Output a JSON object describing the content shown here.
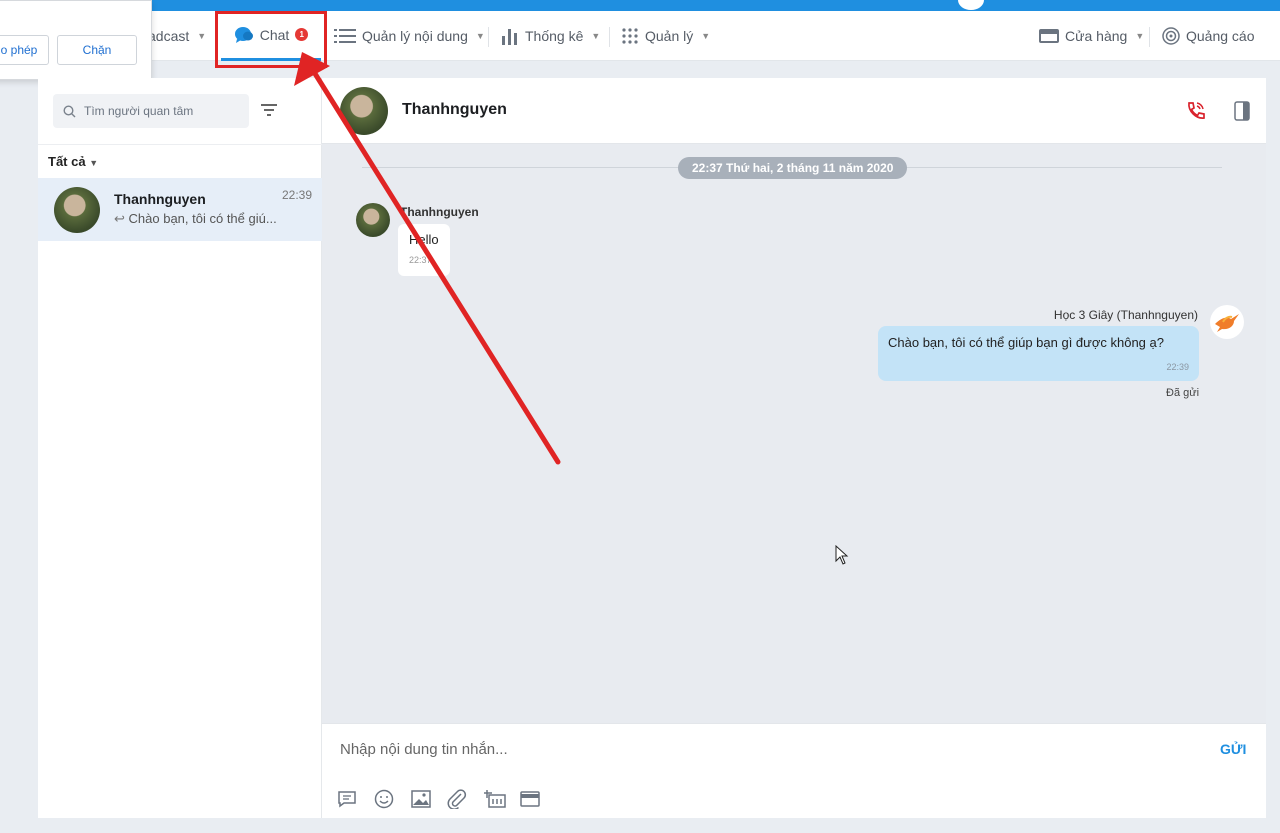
{
  "popup": {
    "allow_label": "o phép",
    "block_label": "Chặn"
  },
  "nav": {
    "broadcast": "adcast",
    "chat": "Chat",
    "chat_badge": "1",
    "content": "Quản lý nội dung",
    "stats": "Thống kê",
    "manage": "Quản lý",
    "store": "Cửa hàng",
    "ads": "Quảng cáo"
  },
  "sidebar": {
    "search_placeholder": "Tìm người quan tâm",
    "filter_label": "Tất cả",
    "conversation": {
      "name": "Thanhnguyen",
      "time": "22:39",
      "preview": "Chào bạn, tôi có thể giú..."
    }
  },
  "chat": {
    "title": "Thanhnguyen",
    "date_separator": "22:37 Thứ hai, 2 tháng 11 năm 2020",
    "incoming": {
      "sender": "Thanhnguyen",
      "text": "Hello",
      "time": "22:37"
    },
    "outgoing": {
      "sender": "Học 3 Giây (Thanhnguyen)",
      "text": "Chào bạn, tôi có thể giúp bạn gì được không ạ?",
      "time": "22:39",
      "status": "Đã gửi"
    },
    "composer_placeholder": "Nhập nội dung tin nhắn...",
    "send_label": "GỬI"
  },
  "colors": {
    "accent": "#1f8fe0",
    "annotation": "#e02424",
    "outgoing_bubble": "#c3e3f7"
  }
}
